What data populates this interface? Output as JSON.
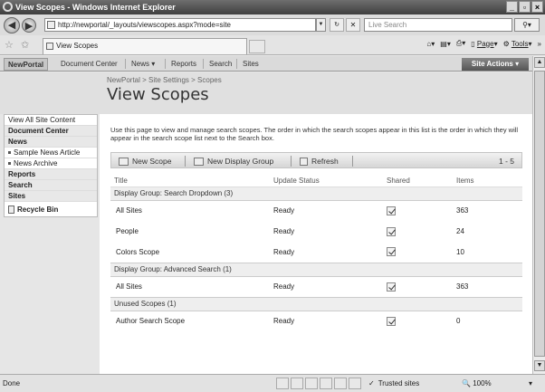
{
  "window": {
    "title": "View Scopes - Windows Internet Explorer"
  },
  "browser": {
    "address": "http://newportal/_layouts/viewscopes.aspx?mode=site",
    "search_placeholder": "Live Search",
    "tab_title": "View Scopes",
    "commands": [
      "Page",
      "Tools"
    ]
  },
  "topnav": {
    "site": "NewPortal",
    "items": [
      "Document Center",
      "News",
      "Reports",
      "Search",
      "Sites"
    ],
    "site_actions": "Site Actions"
  },
  "header": {
    "breadcrumb": "NewPortal > Site Settings > Scopes",
    "title": "View Scopes"
  },
  "leftnav": {
    "view_all": "View All Site Content",
    "document_center": "Document Center",
    "news": "News",
    "news_items": [
      "Sample News Article",
      "News Archive"
    ],
    "reports": "Reports",
    "search": "Search",
    "sites": "Sites",
    "recycle_bin": "Recycle Bin"
  },
  "main": {
    "description": "Use this page to view and manage search scopes. The order in which the search scopes appear in this list is the order in which they will appear in the search scope list next to the Search box.",
    "toolbar": {
      "new_scope": "New Scope",
      "new_display_group": "New Display Group",
      "refresh": "Refresh",
      "paging": "1 - 5"
    },
    "columns": [
      "Title",
      "Update Status",
      "Shared",
      "Items"
    ],
    "groups": [
      {
        "name": "Display Group: Search Dropdown (3)",
        "rows": [
          {
            "title": "All Sites",
            "status": "Ready",
            "shared": true,
            "items": "363"
          },
          {
            "title": "People",
            "status": "Ready",
            "shared": true,
            "items": "24"
          },
          {
            "title": "Colors Scope",
            "status": "Ready",
            "shared": true,
            "items": "10"
          }
        ]
      },
      {
        "name": "Display Group: Advanced Search (1)",
        "rows": [
          {
            "title": "All Sites",
            "status": "Ready",
            "shared": true,
            "items": "363"
          }
        ]
      },
      {
        "name": "Unused Scopes (1)",
        "rows": [
          {
            "title": "Author Search Scope",
            "status": "Ready",
            "shared": true,
            "items": "0"
          }
        ]
      }
    ]
  },
  "statusbar": {
    "left": "Done",
    "zone": "Trusted sites",
    "zoom": "100%"
  }
}
